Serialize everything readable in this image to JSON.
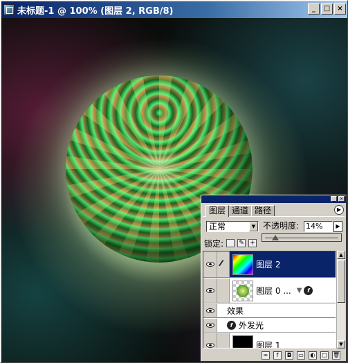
{
  "window": {
    "title": "未标题-1 @ 100% (图层 2, RGB/8)",
    "buttons": {
      "minimize": "_",
      "maximize": "□",
      "close": "×"
    }
  },
  "layers_panel": {
    "tabs": [
      "图层",
      "通道",
      "路径"
    ],
    "active_tab": 0,
    "blend_mode": "正常",
    "opacity_label": "不透明度:",
    "opacity_value": "14%",
    "opacity_fraction": 0.14,
    "lock_label": "锁定:",
    "layers": [
      {
        "name": "图层 2",
        "selected": true,
        "visible": true,
        "thumb": "rainbow-gradient",
        "icon": "brush-icon"
      },
      {
        "name": "图层 0 ...",
        "selected": false,
        "visible": true,
        "thumb": "sphere",
        "has_effects": true
      },
      {
        "name": "效果",
        "sub": true,
        "visible": true
      },
      {
        "name": "外发光",
        "sub": true,
        "visible": true,
        "fx": true
      },
      {
        "name": "图层 1",
        "selected": false,
        "visible": true,
        "thumb": "black"
      }
    ],
    "colors": {
      "selection": "#0a246a",
      "panel_bg": "#d4d0c8"
    }
  }
}
